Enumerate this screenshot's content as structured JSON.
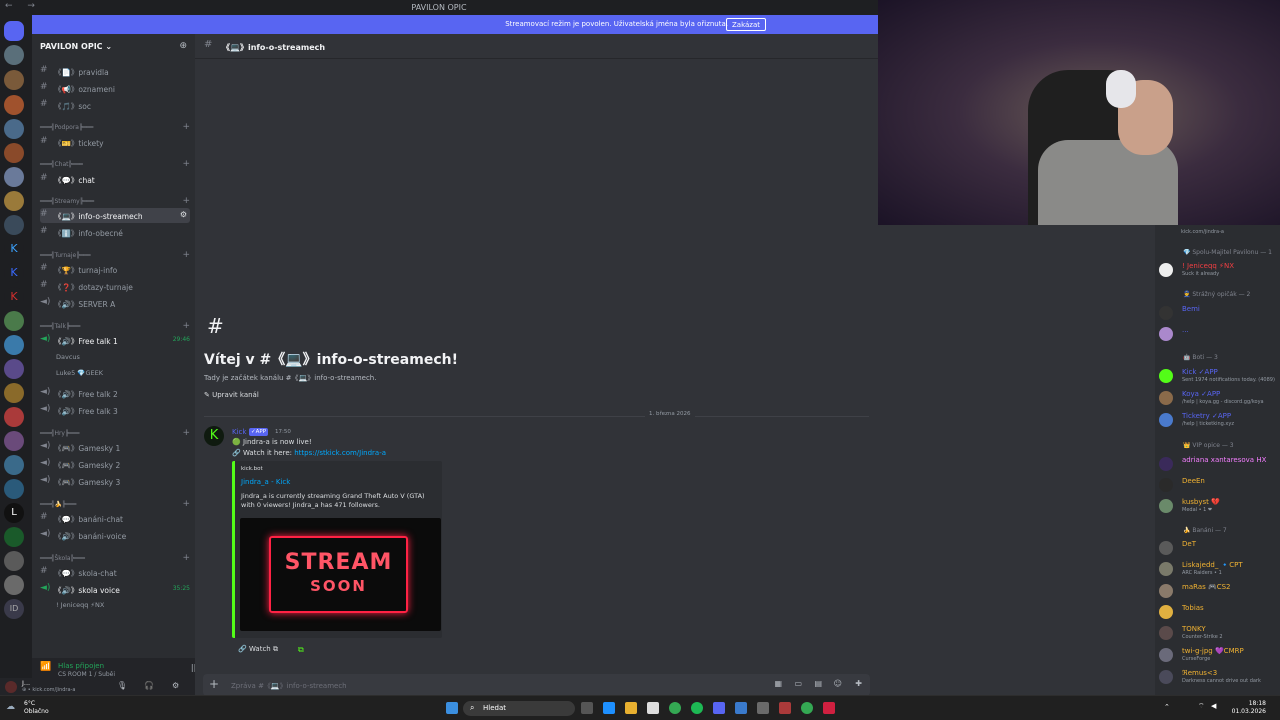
{
  "window": {
    "title": "PAVILON OPIC",
    "nav": "← →"
  },
  "banner": {
    "text": "Streamovací režim je povolen. Uživatelská jména byla ořiznuta.",
    "button": "Zakázat"
  },
  "server": {
    "name": "PAVILON OPIC ⌄"
  },
  "channels": [
    {
      "label": "《📄》pravidla"
    },
    {
      "label": "《📢》oznameni"
    },
    {
      "label": "《🎵》soc"
    },
    {
      "label": "《🎫》tickety"
    },
    {
      "label": "《💬》chat"
    },
    {
      "label": "《💻》info-o-streamech"
    },
    {
      "label": "《ℹ️》info-obecné"
    },
    {
      "label": "《🏆》turnaj-info"
    },
    {
      "label": "《❓》dotazy-turnaje"
    },
    {
      "label": "《🔊》SERVER A"
    },
    {
      "label": "《🔊》Free talk 1"
    },
    {
      "label": "《🔊》Free talk 2"
    },
    {
      "label": "《🔊》Free talk 3"
    },
    {
      "label": "《🎮》Gamesky 1"
    },
    {
      "label": "《🎮》Gamesky 2"
    },
    {
      "label": "《🎮》Gamesky 3"
    },
    {
      "label": "《💬》banáni-chat"
    },
    {
      "label": "《🔊》banáni-voice"
    },
    {
      "label": "《💬》skola-chat"
    },
    {
      "label": "《🔊》skola voice"
    }
  ],
  "categories": [
    "═══╣Podpora╠═══",
    "═══╣Chat╠═══",
    "═══╣Streamy╠═══",
    "═══╣Turnaje╠═══",
    "═══╣Talk╠═══",
    "═══╣Hry╠═══",
    "═══╣🍌╠═══",
    "═══╣Škola╠═══"
  ],
  "voice_users": {
    "davcus": "Davcus",
    "luke": "Luke5  💎GEEK",
    "free1_timer": "29:46",
    "skola_timer": "35:25",
    "jenicekqq": "! Jeniceqq ⚡NX"
  },
  "voice_panel": {
    "status": "Hlas připojen",
    "sub": "CS ROOM 1 / Suběi"
  },
  "user_panel": {
    "name": "J...",
    "status": "⊕ • kick.com/Jindra-a"
  },
  "header": {
    "channel": "《💻》info-o-streamech"
  },
  "welcome": {
    "title": "Vítej v #《💻》info-o-streamech!",
    "subtitle": "Tady je začátek kanálu #《💻》info-o-streamech.",
    "edit": "✎ Upravit kanál"
  },
  "divider_date": "1. března 2026",
  "message": {
    "author": "Kick",
    "badge": "✓APP",
    "time": "17:50",
    "line1": "🟢 Jindra-a is now live!",
    "line2_prefix": "🔗 Watch it here: ",
    "link": "https://stkick.com/Jindra-a",
    "embed": {
      "provider": "kick.bot",
      "title": "Jindra_a - Kick",
      "description": "Jindra_a is currently streaming Grand Theft Auto V (GTA) with 0 viewers! Jindra_a has 471 followers.",
      "image_text1": "STREAM",
      "image_text2": "SOON"
    },
    "watch": "🔗 Watch ⧉"
  },
  "composer": {
    "placeholder": "Zpráva #《💻》info-o-streamech"
  },
  "members": {
    "top_status": "kick.com/jindra-a",
    "roles": [
      "💎 Spolu-Majitel Pavilonu — 1",
      "👮 Strážný opičák — 2",
      "🤖 Boti — 3",
      "👑 VIP opice — 3",
      "🍌 Banáni — 7"
    ],
    "list": [
      {
        "name": "! Jeniceqq ⚡NX",
        "status": "Suck it already",
        "color": "#f23f43"
      },
      {
        "name": "Bemi",
        "status": "",
        "color": "#5865f2"
      },
      {
        "name": "...",
        "status": "",
        "color": "#5865f2"
      },
      {
        "name": "Kick ✓APP",
        "status": "Sent 1974 notifications today. (4089)",
        "color": "#5865f2"
      },
      {
        "name": "Koya ✓APP",
        "status": "/help | koya.gg - discord.gg/koya",
        "color": "#5865f2"
      },
      {
        "name": "Ticketry ✓APP",
        "status": "/help | ticketking.xyz",
        "color": "#5865f2"
      },
      {
        "name": "adriana xantaresova HX",
        "status": "",
        "color": "#f47fff"
      },
      {
        "name": "DeeEn",
        "status": "",
        "color": "#f0b232"
      },
      {
        "name": "kusbyst 💔",
        "status": "Medal • 1 ❤",
        "color": "#f0b232"
      },
      {
        "name": "DeT",
        "status": "",
        "color": "#f0b232"
      },
      {
        "name": "Liskajedd_ 🔹CPT",
        "status": "ARC Raiders • 1",
        "color": "#f0b232"
      },
      {
        "name": "maRas 🎮CS2",
        "status": "",
        "color": "#f0b232"
      },
      {
        "name": "Tobias",
        "status": "",
        "color": "#f0b232"
      },
      {
        "name": "TONKY",
        "status": "Counter-Strike 2",
        "color": "#f0b232"
      },
      {
        "name": "twi-g-jpg 💜CMRP",
        "status": "CurseForge",
        "color": "#f0b232"
      },
      {
        "name": "ℜemus<3",
        "status": "Darkness cannot drive out dark",
        "color": "#f0b232"
      }
    ]
  },
  "taskbar": {
    "weather1": "6°C",
    "weather2": "Oblačno",
    "search": "Hledat",
    "time": "18:18",
    "date": "01.03.2026"
  },
  "colors": {
    "accent": "#5865f2",
    "kick_green": "#53fc18",
    "online": "#23a55a"
  }
}
